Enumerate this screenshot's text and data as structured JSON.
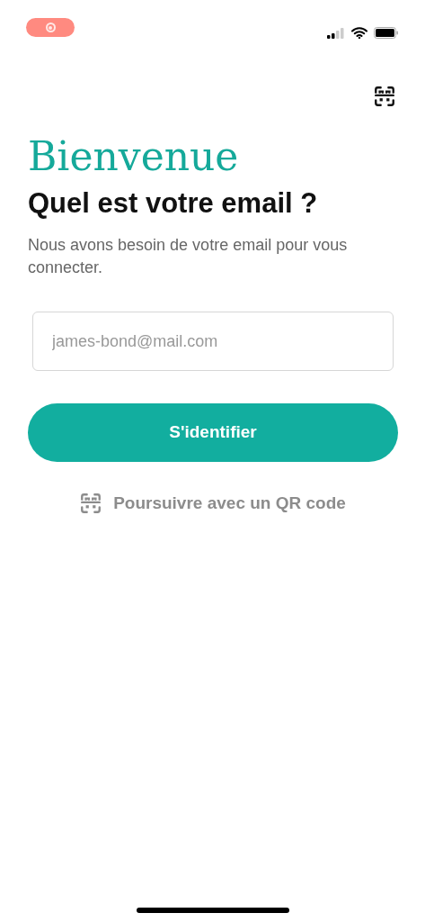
{
  "title": "Bienvenue",
  "heading": "Quel est votre email ?",
  "description": "Nous avons besoin de votre email pour vous connecter.",
  "email_field": {
    "placeholder": "james-bond@mail.com"
  },
  "submit_button": {
    "label": "S'identifier"
  },
  "qr_link": {
    "label": "Poursuivre avec un QR code"
  }
}
